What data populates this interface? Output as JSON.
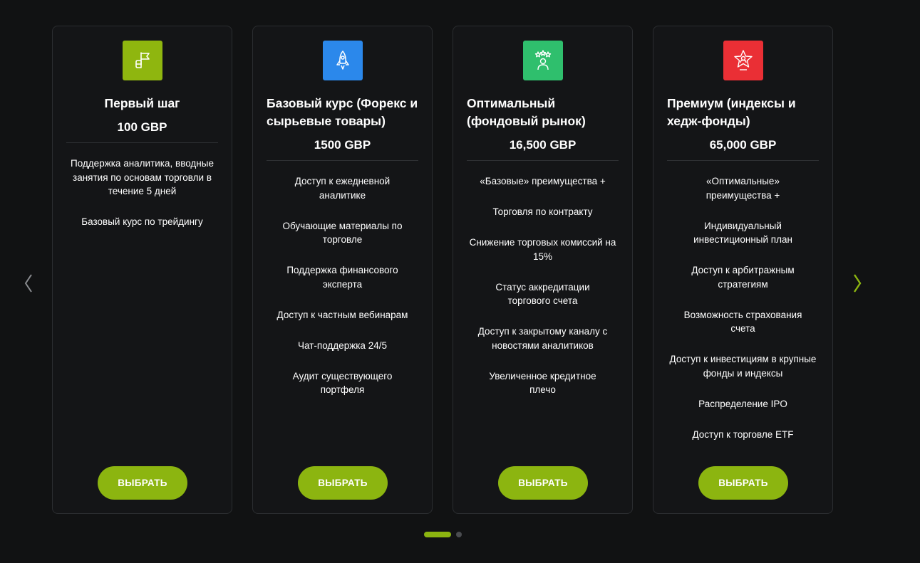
{
  "colors": {
    "background": "#111213",
    "card": "#141517",
    "accent_green": "#8cb510",
    "icon_green_light": "#8fb60f",
    "icon_blue": "#2b88eb",
    "icon_green": "#2fbf6d",
    "icon_red": "#ea2f35"
  },
  "nav": {
    "prev_icon": "chevron-left-icon",
    "next_icon": "chevron-right-icon"
  },
  "cards": [
    {
      "icon": "flag-hand-icon",
      "title": "Первый шаг",
      "price": "100 GBP",
      "features": [
        "Поддержка аналитика, вводные занятия по основам торговли в течение 5 дней",
        "Базовый курс по трейдингу"
      ],
      "button": "ВЫБРАТЬ"
    },
    {
      "icon": "rocket-icon",
      "title": "Базовый курс (Форекс и сырьевые товары)",
      "price": "1500 GBP",
      "features": [
        "Доступ к ежедневной аналитике",
        "Обучающие материалы по торговле",
        "Поддержка финансового эксперта",
        "Доступ к частным вебинарам",
        "Чат-поддержка 24/5",
        "Аудит существующего портфеля"
      ],
      "button": "ВЫБРАТЬ"
    },
    {
      "icon": "person-stars-icon",
      "title": "Оптимальный (фондовый рынок)",
      "price": "16,500 GBP",
      "features": [
        "«Базовые» преимущества +",
        "Торговля по контракту",
        "Снижение торговых комиссий на 15%",
        "Статус аккредитации торгового счета",
        "Доступ к закрытому каналу с новостями аналитиков",
        "Увеличенное кредитное плечо"
      ],
      "button": "ВЫБРАТЬ"
    },
    {
      "icon": "star-person-icon",
      "title": "Премиум (индексы и хедж-фонды)",
      "price": "65,000 GBP",
      "features": [
        "«Оптимальные» преимущества +",
        "Индивидуальный инвестиционный план",
        "Доступ к арбитражным стратегиям",
        "Возможность страхования счета",
        "Доступ к инвестициям в крупные фонды и индексы",
        "Распределение IPO",
        "Доступ к торговле ETF"
      ],
      "button": "ВЫБРАТЬ"
    }
  ],
  "pagination": {
    "pages": 2,
    "active": 1
  }
}
